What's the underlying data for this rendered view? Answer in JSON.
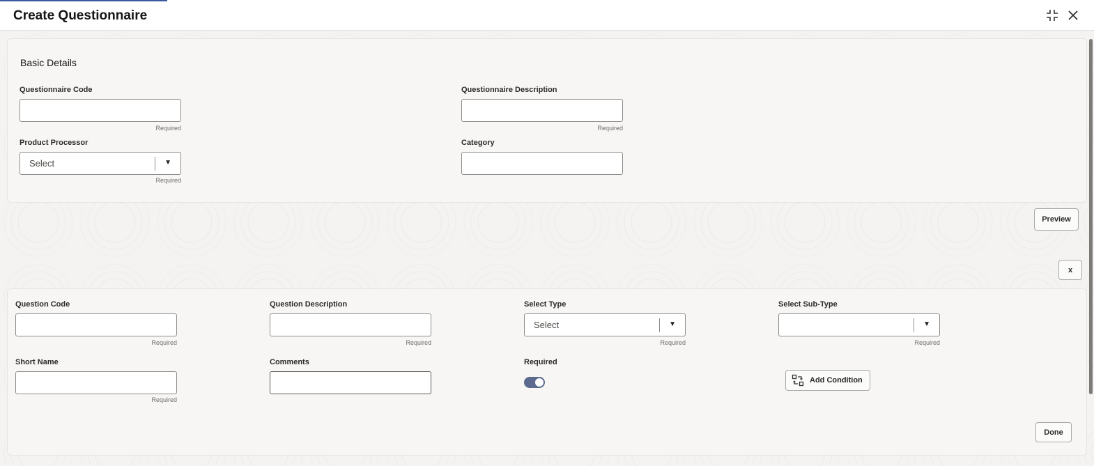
{
  "dialog": {
    "title": "Create Questionnaire"
  },
  "basic_details": {
    "heading": "Basic Details",
    "questionnaire_code": {
      "label": "Questionnaire Code",
      "value": "",
      "hint": "Required"
    },
    "questionnaire_description": {
      "label": "Questionnaire Description",
      "value": "",
      "hint": "Required"
    },
    "product_processor": {
      "label": "Product Processor",
      "value": "Select",
      "hint": "Required"
    },
    "category": {
      "label": "Category",
      "value": ""
    }
  },
  "preview_button": "Preview",
  "remove_button": "x",
  "question": {
    "question_code": {
      "label": "Question Code",
      "value": "",
      "hint": "Required"
    },
    "question_description": {
      "label": "Question Description",
      "value": "",
      "hint": "Required"
    },
    "select_type": {
      "label": "Select Type",
      "value": "Select",
      "hint": "Required"
    },
    "select_sub_type": {
      "label": "Select Sub-Type",
      "value": "",
      "hint": "Required"
    },
    "short_name": {
      "label": "Short Name",
      "value": "",
      "hint": "Required"
    },
    "comments": {
      "label": "Comments",
      "value": ""
    },
    "required": {
      "label": "Required",
      "on": true
    },
    "add_condition_button": "Add Condition",
    "done_button": "Done"
  },
  "icons": {
    "minimize": "collapse-icon",
    "close": "close-icon",
    "dropdown": "chevron-down-icon",
    "condition": "condition-icon"
  }
}
